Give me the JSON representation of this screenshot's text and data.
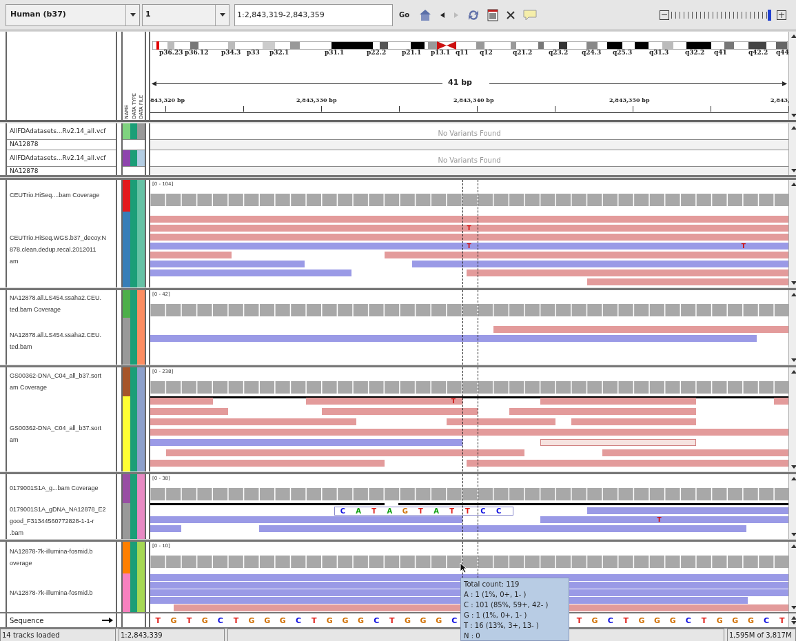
{
  "toolbar": {
    "genome": "Human (b37)",
    "chromosome": "1",
    "locus": "1:2,843,319-2,843,359",
    "go": "Go",
    "forward_disabled": true,
    "zoom": {
      "level": 0.95
    }
  },
  "header": {
    "attribute_labels": [
      "NAME",
      "DATA TYPE",
      "DATA FILE"
    ],
    "bands": [
      "p36.23",
      "p36.12",
      "p34.3",
      "p33",
      "p32.1",
      "p31.1",
      "p22.2",
      "p21.1",
      "p13.1",
      "q11",
      "q12",
      "q21.2",
      "q23.2",
      "q24.3",
      "q25.3",
      "q31.3",
      "q32.2",
      "q41",
      "q42.2",
      "q44"
    ],
    "span": "41 bp",
    "ticks": [
      "843,320 bp",
      "2,843,330 bp",
      "2,843,340 bp",
      "2,843,350 bp",
      "2,843,"
    ]
  },
  "variant_panel": {
    "tracks": [
      {
        "name": "AllFDAdatasets...Rv2.14_all.vcf",
        "colors": [
          {
            "color": "#7fd37f"
          },
          {
            "color": "#1b9e77"
          },
          {
            "color": "#999999"
          }
        ],
        "message": "No Variants Found"
      },
      {
        "name": "NA12878"
      },
      {
        "name": "AllFDAdatasets...Rv2.14_all.vcf",
        "colors": [
          {
            "color": "#8e44ad"
          },
          {
            "color": "#1b9e77"
          },
          {
            "color": "#b3cde3"
          }
        ],
        "message": "No Variants Found"
      },
      {
        "name": "NA12878"
      }
    ]
  },
  "panels": [
    {
      "coverage": {
        "name": "CEUTrio.HiSeq....bam Coverage",
        "range": "[0 - 104]",
        "colors": [
          {
            "color": "#e31a1c"
          },
          {
            "color": "#1b9e77"
          },
          {
            "color": "#66c2a5"
          }
        ]
      },
      "alignment": {
        "name_lines": [
          "CEUTrio.HiSeq.WGS.b37_decoy.N",
          "878.clean.dedup.recal.2012011",
          "am"
        ],
        "colors": [
          {
            "color": "#377eb8"
          },
          {
            "color": "#1b9e77"
          },
          {
            "color": "#66c2a5"
          }
        ],
        "mismatches": [
          "T",
          "T",
          "T"
        ]
      }
    },
    {
      "coverage": {
        "name_lines": [
          "NA12878.all.LS454.ssaha2.CEU.",
          "ted.bam Coverage"
        ],
        "range": "[0 - 42]",
        "colors": [
          {
            "color": "#4daf4a"
          },
          {
            "color": "#1b9e77"
          },
          {
            "color": "#fc8d62"
          }
        ]
      },
      "alignment": {
        "name_lines": [
          "NA12878.all.LS454.ssaha2.CEU.",
          "ted.bam"
        ],
        "colors": [
          {
            "color": "#999999"
          },
          {
            "color": "#1b9e77"
          },
          {
            "color": "#fc8d62"
          }
        ]
      }
    },
    {
      "coverage": {
        "name_lines": [
          "GS00362-DNA_C04_all_b37.sort",
          "am Coverage"
        ],
        "range": "[0 - 238]",
        "colors": [
          {
            "color": "#a6562b"
          },
          {
            "color": "#1b9e77"
          },
          {
            "color": "#8da0cb"
          }
        ]
      },
      "alignment": {
        "name_lines": [
          "GS00362-DNA_C04_all_b37.sort",
          "am"
        ],
        "colors": [
          {
            "color": "#ffff33"
          },
          {
            "color": "#1b9e77"
          },
          {
            "color": "#8da0cb"
          }
        ],
        "mismatches": [
          "T"
        ]
      }
    },
    {
      "coverage": {
        "name": "0179001S1A_g...bam Coverage",
        "range": "[0 - 38]",
        "colors": [
          {
            "color": "#984ea3"
          },
          {
            "color": "#1b9e77"
          },
          {
            "color": "#e78ac3"
          }
        ]
      },
      "alignment": {
        "name_lines": [
          "0179001S1A_gDNA_NA12878_E2",
          "good_F31344560772828-1-1-r",
          ".bam"
        ],
        "colors": [
          {
            "color": "#999999"
          },
          {
            "color": "#1b9e77"
          },
          {
            "color": "#e78ac3"
          }
        ],
        "mismatches": [
          "T"
        ],
        "read_bases": [
          {
            "base": "C",
            "color": "#1010e0"
          },
          {
            "base": "A",
            "color": "#10a010"
          },
          {
            "base": "T",
            "color": "#e0201b"
          },
          {
            "base": "A",
            "color": "#10a010"
          },
          {
            "base": "G",
            "color": "#d17105"
          },
          {
            "base": "T",
            "color": "#e0201b"
          },
          {
            "base": "A",
            "color": "#10a010"
          },
          {
            "base": "T",
            "color": "#e0201b"
          },
          {
            "base": "T",
            "color": "#e0201b"
          },
          {
            "base": "C",
            "color": "#1010e0"
          },
          {
            "base": "C",
            "color": "#1010e0"
          }
        ]
      }
    },
    {
      "coverage": {
        "name_lines": [
          "NA12878-7k-illumina-fosmid.b",
          "overage"
        ],
        "range": "[0 - 10]",
        "colors": [
          {
            "color": "#ff7f00"
          },
          {
            "color": "#1b9e77"
          },
          {
            "color": "#a6d854"
          }
        ]
      },
      "alignment": {
        "name_lines": [
          "NA12878-7k-illumina-fosmid.b"
        ],
        "colors": [
          {
            "color": "#f781bf"
          },
          {
            "color": "#1b9e77"
          },
          {
            "color": "#a6d854"
          }
        ]
      }
    }
  ],
  "sequence": {
    "label": "Sequence",
    "bases_left": [
      {
        "base": "T",
        "color": "#e0201b"
      },
      {
        "base": "G",
        "color": "#d17105"
      },
      {
        "base": "T",
        "color": "#e0201b"
      },
      {
        "base": "G",
        "color": "#d17105"
      },
      {
        "base": "C",
        "color": "#1010e0"
      },
      {
        "base": "T",
        "color": "#e0201b"
      },
      {
        "base": "G",
        "color": "#d17105"
      },
      {
        "base": "G",
        "color": "#d17105"
      },
      {
        "base": "G",
        "color": "#d17105"
      },
      {
        "base": "C",
        "color": "#1010e0"
      },
      {
        "base": "T",
        "color": "#e0201b"
      },
      {
        "base": "G",
        "color": "#d17105"
      },
      {
        "base": "G",
        "color": "#d17105"
      },
      {
        "base": "G",
        "color": "#d17105"
      },
      {
        "base": "C",
        "color": "#1010e0"
      },
      {
        "base": "T",
        "color": "#e0201b"
      },
      {
        "base": "G",
        "color": "#d17105"
      },
      {
        "base": "G",
        "color": "#d17105"
      },
      {
        "base": "G",
        "color": "#d17105"
      },
      {
        "base": "C",
        "color": "#1010e0"
      }
    ],
    "bases_right": [
      {
        "base": "T",
        "color": "#e0201b"
      },
      {
        "base": "G",
        "color": "#d17105"
      },
      {
        "base": "C",
        "color": "#1010e0"
      },
      {
        "base": "T",
        "color": "#e0201b"
      },
      {
        "base": "G",
        "color": "#d17105"
      },
      {
        "base": "G",
        "color": "#d17105"
      },
      {
        "base": "G",
        "color": "#d17105"
      },
      {
        "base": "C",
        "color": "#1010e0"
      },
      {
        "base": "T",
        "color": "#e0201b"
      },
      {
        "base": "G",
        "color": "#d17105"
      },
      {
        "base": "G",
        "color": "#d17105"
      },
      {
        "base": "G",
        "color": "#d17105"
      },
      {
        "base": "C",
        "color": "#1010e0"
      },
      {
        "base": "T",
        "color": "#e0201b"
      }
    ]
  },
  "tooltip": {
    "lines": [
      "Total count: 119",
      "A : 1 (1%, 0+, 1- )",
      "C : 101 (85%, 59+, 42- )",
      "G : 1 (1%, 0+, 1- )",
      "T : 16 (13%, 3+, 13- )",
      "N : 0"
    ]
  },
  "status_bar": {
    "message": "14 tracks loaded",
    "position": "1:2,843,339",
    "memory": "1,595M of 3,817M"
  }
}
